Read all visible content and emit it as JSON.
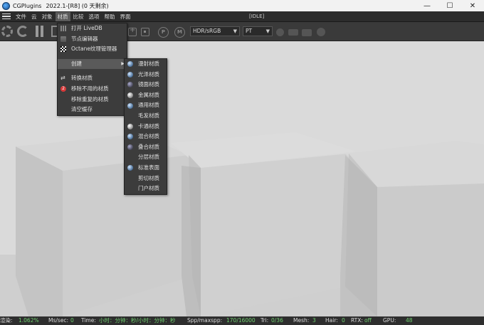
{
  "window": {
    "app_name": "CGPlugins",
    "version": "2022.1-[R8] (0 天剩余)",
    "controls": [
      "—",
      "☐",
      "✕"
    ]
  },
  "menubar": {
    "items": [
      "文件",
      "云",
      "对象",
      "材质",
      "比较",
      "选项",
      "帮助",
      "界面"
    ],
    "active_index": 3,
    "render_status": "[IDLE]"
  },
  "toolbar": {
    "color_space": "HDR/sRGB",
    "kernel": "PT",
    "round_icon_p": "P",
    "round_icon_m": "M"
  },
  "material_menu": {
    "items": [
      {
        "label": "打开 LiveDB",
        "icon": "grid-icon"
      },
      {
        "label": "节点编辑器",
        "icon": "node-editor-icon"
      },
      {
        "label": "Octane纹理管理器",
        "icon": "checker-icon"
      },
      {
        "label": "创建",
        "icon": "",
        "has_submenu": true,
        "highlighted": true
      },
      {
        "label": "转换材质",
        "icon": "swap-icon"
      },
      {
        "label": "移除不用的材质",
        "icon": "remove-badge-icon",
        "badge": "2"
      },
      {
        "label": "移除重复的材质",
        "icon": ""
      },
      {
        "label": "清空缓存",
        "icon": ""
      }
    ]
  },
  "create_submenu": {
    "items": [
      {
        "label": "漫射材质",
        "icon": "sphere"
      },
      {
        "label": "光泽材质",
        "icon": "sphere"
      },
      {
        "label": "镜面材质",
        "icon": "sphere-dark"
      },
      {
        "label": "金属材质",
        "icon": "sphere-grey"
      },
      {
        "label": "通用材质",
        "icon": "sphere"
      },
      {
        "label": "毛发材质",
        "icon": ""
      },
      {
        "label": "卡通材质",
        "icon": "sphere-grey"
      },
      {
        "label": "混合材质",
        "icon": "sphere"
      },
      {
        "label": "叠合材质",
        "icon": "sphere-dark"
      },
      {
        "label": "分层材质",
        "icon": ""
      },
      {
        "label": "标准表面",
        "icon": "sphere"
      },
      {
        "label": "剪切材质",
        "icon": ""
      },
      {
        "label": "门户材质",
        "icon": ""
      }
    ]
  },
  "statusbar": {
    "render_label": "渲染:",
    "render_value": "1.062%",
    "ms_label": "Ms/sec:",
    "ms_value": "0",
    "time_label": "Time:",
    "time_value": "小时：分钟：秒/小时：分钟：秒",
    "spp_label": "Spp/maxspp:",
    "spp_value": "170/16000",
    "tri_label": "Tri:",
    "tri_value": "0/36",
    "mesh_label": "Mesh:",
    "mesh_value": "3",
    "hair_label": "Hair:",
    "hair_value": "0",
    "rtx_label": "RTX:",
    "rtx_value": "off",
    "gpu_label": "GPU:",
    "gpu_value": "48"
  },
  "colors": {
    "titlebar_bg": "#f2f2f2",
    "ui_dark": "#2c2c2c",
    "menu_bg": "#3c3c3c",
    "menu_highlight": "#5a5a5a",
    "viewport_bg": "#d9d9d9",
    "status_value": "#6fcf6f"
  }
}
